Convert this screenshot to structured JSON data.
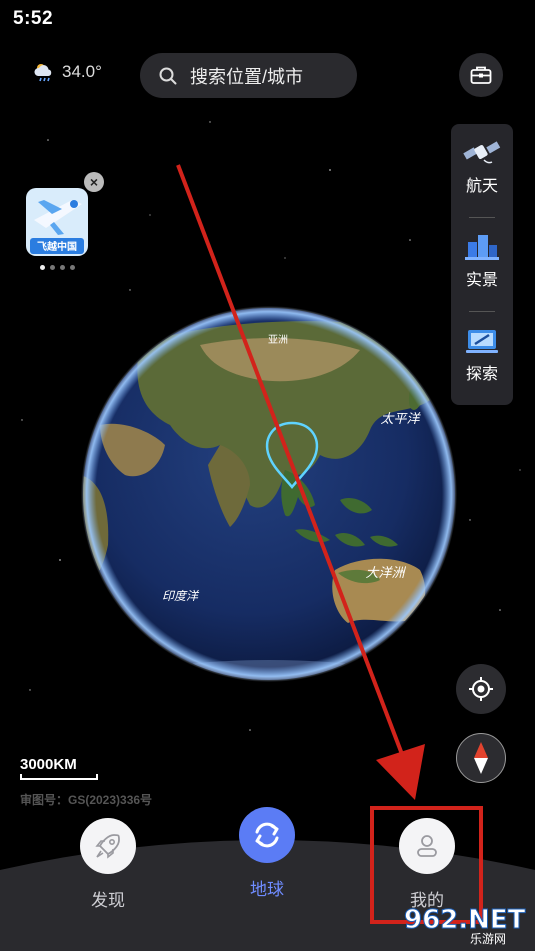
{
  "status_bar": {
    "time": "5:52"
  },
  "weather": {
    "temperature": "34.0°",
    "icon": "partly-cloudy-rain-icon"
  },
  "search": {
    "placeholder": "搜索位置/城市"
  },
  "toolbox": {
    "icon": "toolbox-icon"
  },
  "right_panel": {
    "items": [
      {
        "label": "航天",
        "icon": "satellite-icon"
      },
      {
        "label": "实景",
        "icon": "city-buildings-icon"
      },
      {
        "label": "探索",
        "icon": "explore-icon"
      }
    ]
  },
  "promo": {
    "badge_text": "飞越中国",
    "close": "×",
    "carousel_count": 4,
    "carousel_active": 0
  },
  "globe": {
    "labels": {
      "asia": "亚洲",
      "pacific": "太平洋",
      "indian_ocean": "印度洋",
      "oceania": "大洋洲"
    }
  },
  "map_tools": {
    "locate_icon": "locate-crosshair-icon",
    "compass_icon": "compass-icon"
  },
  "scale": {
    "label": "3000KM"
  },
  "approval": {
    "text": "审图号：GS(2023)336号"
  },
  "bottom_nav": {
    "items": [
      {
        "label": "发现",
        "icon": "rocket-icon",
        "active": false
      },
      {
        "label": "地球",
        "icon": "refresh-globe-icon",
        "active": true
      },
      {
        "label": "我的",
        "icon": "user-icon",
        "active": false
      }
    ]
  },
  "annotation": {
    "arrow_color": "#d2231b",
    "box_color": "#d2231b"
  },
  "watermark": {
    "text": "962.NET",
    "subtext": "乐游网"
  },
  "colors": {
    "accent": "#5b7cf5",
    "panel_bg": "#26262b",
    "ocean": "#1a2f6b"
  }
}
